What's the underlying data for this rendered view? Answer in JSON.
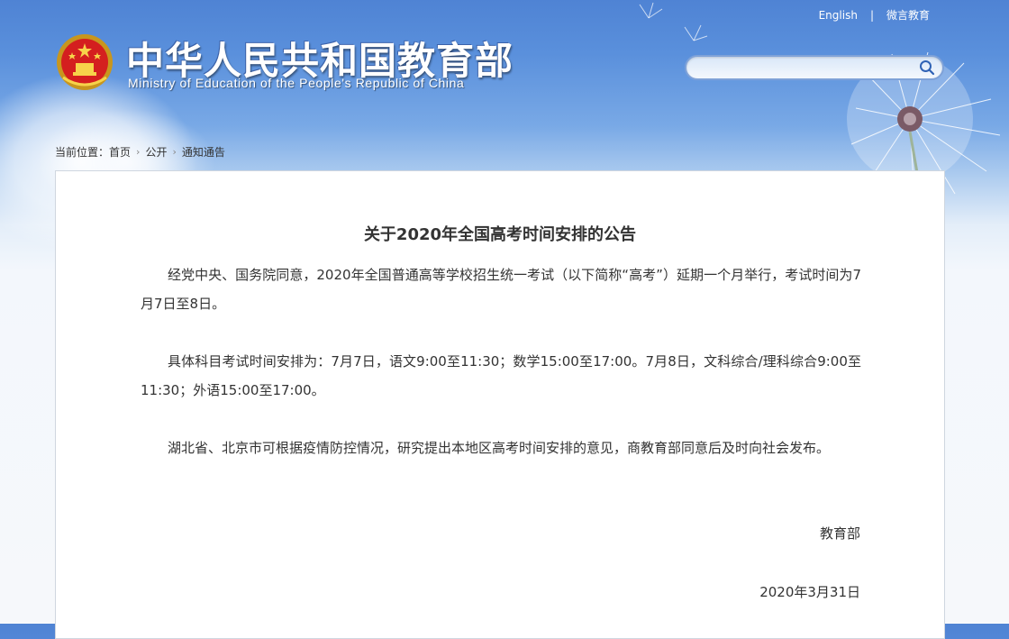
{
  "header": {
    "site_title": "中华人民共和国教育部",
    "site_subtitle": "Ministry of Education of the People's Republic of China",
    "emblem_icon": "national-emblem-icon"
  },
  "top_links": {
    "english": "English",
    "separator": "|",
    "weibo": "微言教育"
  },
  "search": {
    "placeholder": "",
    "value": "",
    "icon": "search-icon"
  },
  "breadcrumb": {
    "label": "当前位置：",
    "items": [
      "首页",
      "公开",
      "通知通告"
    ],
    "separator_icon": "chevron-right-icon"
  },
  "article": {
    "title": "关于2020年全国高考时间安排的公告",
    "paragraphs": [
      "经党中央、国务院同意，2020年全国普通高等学校招生统一考试（以下简称“高考”）延期一个月举行，考试时间为7月7日至8日。",
      "具体科目考试时间安排为：7月7日，语文9:00至11:30；数学15:00至17:00。7月8日，文科综合/理科综合9:00至11:30；外语15:00至17:00。",
      "湖北省、北京市可根据疫情防控情况，研究提出本地区高考时间安排的意见，商教育部同意后及时向社会发布。"
    ],
    "signature_org": "教育部",
    "signature_date": "2020年3月31日"
  },
  "colors": {
    "header_blue": "#4f83d4",
    "panel_border": "#cfd6df",
    "text": "#333333"
  }
}
